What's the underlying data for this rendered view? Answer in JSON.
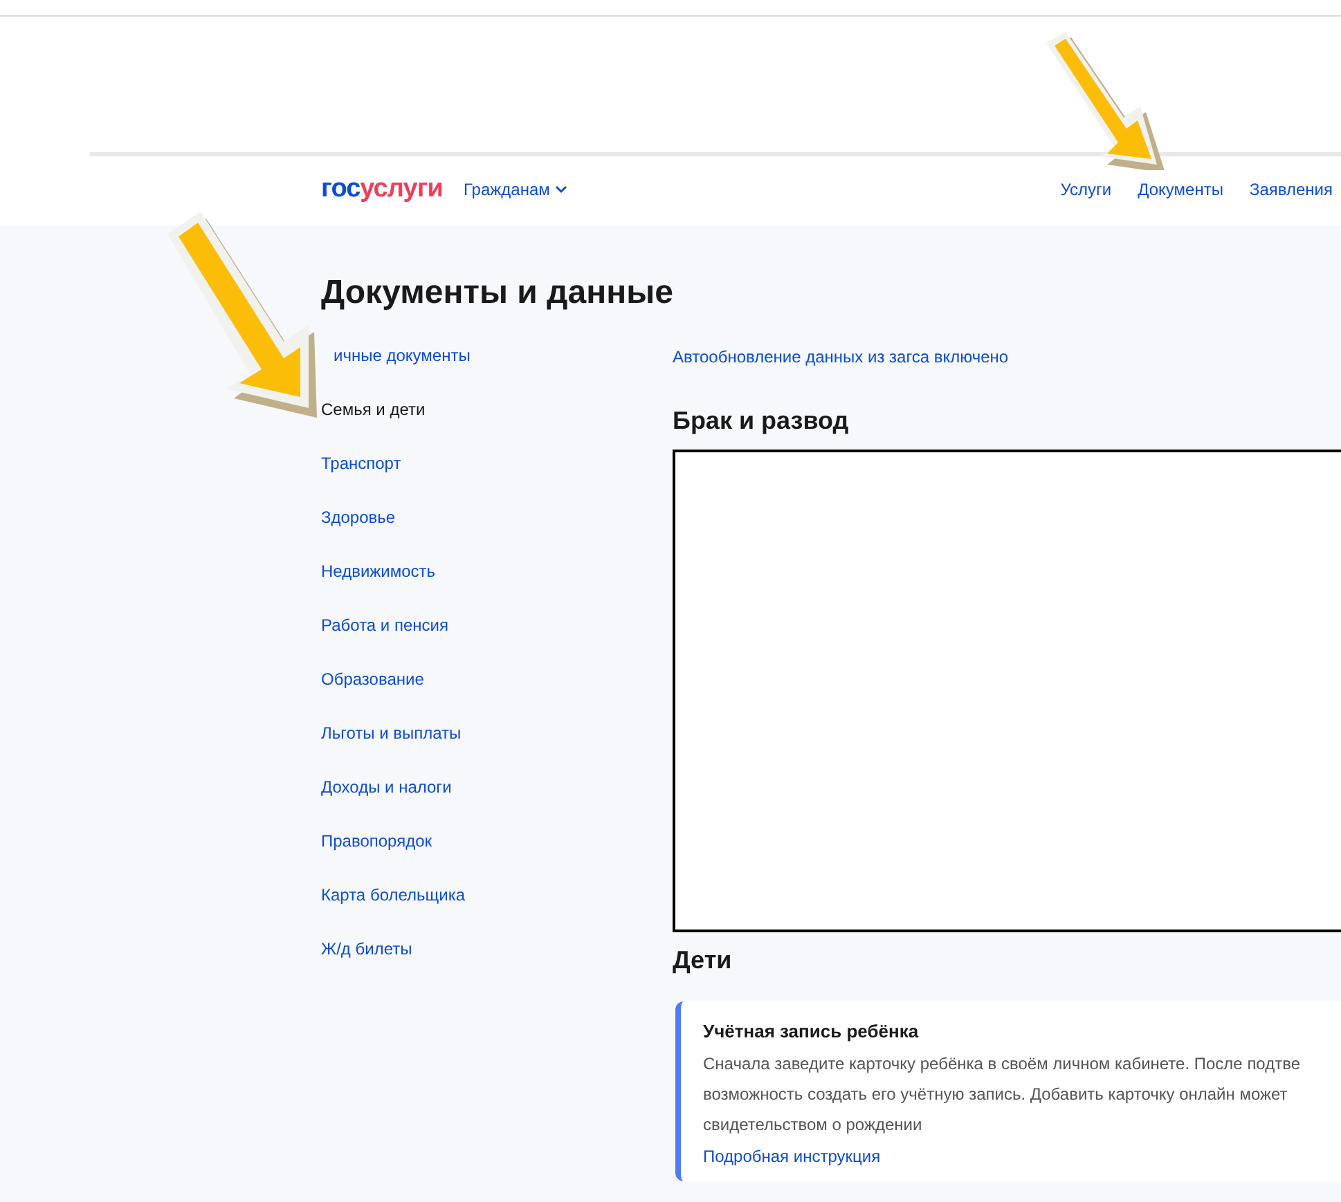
{
  "header": {
    "logo": {
      "part1": "гос",
      "part2": "услуги"
    },
    "audience_menu": "Гражданам",
    "nav": [
      {
        "label": "Услуги",
        "selected": false
      },
      {
        "label": "Документы",
        "selected": false
      },
      {
        "label": "Заявления",
        "selected": false
      }
    ]
  },
  "page_title": "Документы и данные",
  "sidebar": {
    "items": [
      {
        "label": "ичные документы",
        "selected": false
      },
      {
        "label": "Семья и дети",
        "selected": true
      },
      {
        "label": "Транспорт",
        "selected": false
      },
      {
        "label": "Здоровье",
        "selected": false
      },
      {
        "label": "Недвижимость",
        "selected": false
      },
      {
        "label": "Работа и пенсия",
        "selected": false
      },
      {
        "label": "Образование",
        "selected": false
      },
      {
        "label": "Льготы и выплаты",
        "selected": false
      },
      {
        "label": "Доходы и налоги",
        "selected": false
      },
      {
        "label": "Правопорядок",
        "selected": false
      },
      {
        "label": "Карта болельщика",
        "selected": false
      },
      {
        "label": "Ж/д билеты",
        "selected": false
      }
    ]
  },
  "auto_update_link": "Автообновление данных из загса включено",
  "sections": [
    {
      "title": "Брак и развод"
    },
    {
      "title": "Дети"
    }
  ],
  "child_card": {
    "title": "Учётная запись ребёнка",
    "text_lines": [
      "Сначала заведите карточку ребёнка в своём личном кабинете. После подтве",
      "возможность создать его учётную запись. Добавить карточку онлайн может",
      "свидетельством о рождении"
    ],
    "link": "Подробная инструкция"
  }
}
